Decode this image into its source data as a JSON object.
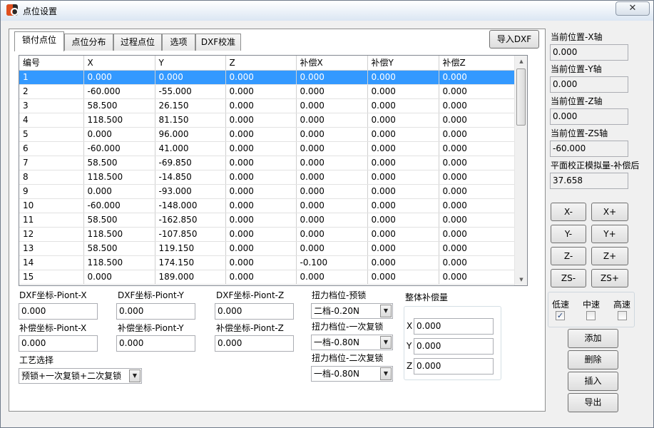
{
  "window": {
    "title": "点位设置",
    "close_glyph": "✕"
  },
  "tabs": [
    "锁付点位",
    "点位分布",
    "过程点位",
    "选项",
    "DXF校准"
  ],
  "import_dxf_label": "导入DXF",
  "table": {
    "columns": [
      "编号",
      "X",
      "Y",
      "Z",
      "补偿X",
      "补偿Y",
      "补偿Z"
    ],
    "rows": [
      [
        "1",
        "0.000",
        "0.000",
        "0.000",
        "0.000",
        "0.000",
        "0.000"
      ],
      [
        "2",
        "-60.000",
        "-55.000",
        "0.000",
        "0.000",
        "0.000",
        "0.000"
      ],
      [
        "3",
        "58.500",
        "26.150",
        "0.000",
        "0.000",
        "0.000",
        "0.000"
      ],
      [
        "4",
        "118.500",
        "81.150",
        "0.000",
        "0.000",
        "0.000",
        "0.000"
      ],
      [
        "5",
        "0.000",
        "96.000",
        "0.000",
        "0.000",
        "0.000",
        "0.000"
      ],
      [
        "6",
        "-60.000",
        "41.000",
        "0.000",
        "0.000",
        "0.000",
        "0.000"
      ],
      [
        "7",
        "58.500",
        "-69.850",
        "0.000",
        "0.000",
        "0.000",
        "0.000"
      ],
      [
        "8",
        "118.500",
        "-14.850",
        "0.000",
        "0.000",
        "0.000",
        "0.000"
      ],
      [
        "9",
        "0.000",
        "-93.000",
        "0.000",
        "0.000",
        "0.000",
        "0.000"
      ],
      [
        "10",
        "-60.000",
        "-148.000",
        "0.000",
        "0.000",
        "0.000",
        "0.000"
      ],
      [
        "11",
        "58.500",
        "-162.850",
        "0.000",
        "0.000",
        "0.000",
        "0.000"
      ],
      [
        "12",
        "118.500",
        "-107.850",
        "0.000",
        "0.000",
        "0.000",
        "0.000"
      ],
      [
        "13",
        "58.500",
        "119.150",
        "0.000",
        "0.000",
        "0.000",
        "0.000"
      ],
      [
        "14",
        "118.500",
        "174.150",
        "0.000",
        "-0.100",
        "0.000",
        "0.000"
      ],
      [
        "15",
        "0.000",
        "189.000",
        "0.000",
        "0.000",
        "0.000",
        "0.000"
      ]
    ],
    "selected_row": 1
  },
  "fields": {
    "dxf_x_label": "DXF坐标-Piont-X",
    "dxf_x_value": "0.000",
    "dxf_y_label": "DXF坐标-Piont-Y",
    "dxf_y_value": "0.000",
    "dxf_z_label": "DXF坐标-Piont-Z",
    "dxf_z_value": "0.000",
    "comp_x_label": "补偿坐标-Piont-X",
    "comp_x_value": "0.000",
    "comp_y_label": "补偿坐标-Piont-Y",
    "comp_y_value": "0.000",
    "comp_z_label": "补偿坐标-Piont-Z",
    "comp_z_value": "0.000",
    "process_label": "工艺选择",
    "process_value": "预锁+一次复锁+二次复锁"
  },
  "torque": {
    "pre_label": "扭力档位-预锁",
    "pre_value": "二档-0.20N",
    "first_label": "扭力档位-一次复锁",
    "first_value": "一档-0.80N",
    "second_label": "扭力档位-二次复锁",
    "second_value": "一档-0.80N"
  },
  "overall_comp": {
    "title": "整体补偿量",
    "x_label": "X",
    "x_value": "0.000",
    "y_label": "Y",
    "y_value": "0.000",
    "z_label": "Z",
    "z_value": "0.000"
  },
  "position": {
    "x_label": "当前位置-X轴",
    "x_value": "0.000",
    "y_label": "当前位置-Y轴",
    "y_value": "0.000",
    "z_label": "当前位置-Z轴",
    "z_value": "0.000",
    "zs_label": "当前位置-ZS轴",
    "zs_value": "-60.000",
    "sim_label": "平面校正模拟量-补偿后",
    "sim_value": "37.658"
  },
  "jog": {
    "x_minus": "X-",
    "x_plus": "X+",
    "y_minus": "Y-",
    "y_plus": "Y+",
    "z_minus": "Z-",
    "z_plus": "Z+",
    "zs_minus": "ZS-",
    "zs_plus": "ZS+"
  },
  "speed": {
    "low": "低速",
    "low_checked": true,
    "mid": "中速",
    "mid_checked": false,
    "high": "高速",
    "high_checked": false,
    "check_glyph": "✓"
  },
  "actions": {
    "add": "添加",
    "delete": "删除",
    "insert": "插入",
    "export": "导出"
  }
}
